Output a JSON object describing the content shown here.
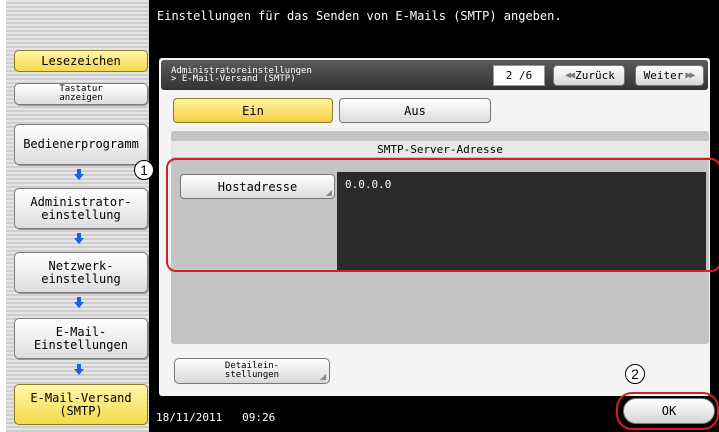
{
  "instruction": "Einstellungen für das Senden von E-Mails (SMTP) angeben.",
  "sidebar": {
    "bookmark_label": "Lesezeichen",
    "keyboard_label": "Tastatur\nanzeigen",
    "items": [
      {
        "label": "Bedienerprogramm"
      },
      {
        "label": "Administrator-\neinstellung"
      },
      {
        "label": "Netzwerk-\neinstellung"
      },
      {
        "label": "E-Mail-\nEinstellungen"
      },
      {
        "label": "E-Mail-Versand\n(SMTP)"
      }
    ]
  },
  "breadcrumb": {
    "text": "Administratoreinstellungen\n> E-Mail-Versand (SMTP)",
    "page_indicator": "2 /6",
    "back_label": "Zurück",
    "next_label": "Weiter"
  },
  "toggle": {
    "on_label": "Ein",
    "off_label": "Aus",
    "selected": "Ein"
  },
  "smtp_server": {
    "header": "SMTP-Server-Adresse",
    "host_button_label": "Hostadresse",
    "host_value": "0.0.0.0"
  },
  "detail_button_label": "Detailein-\nstellungen",
  "status": {
    "date": "18/11/2011",
    "time": "09:26"
  },
  "ok_label": "OK",
  "callouts": {
    "one": "1",
    "two": "2"
  },
  "colors": {
    "selected_yellow": "#f5d94a",
    "callout_red": "#d62020",
    "step_arrow_blue": "#1f5fe0"
  }
}
